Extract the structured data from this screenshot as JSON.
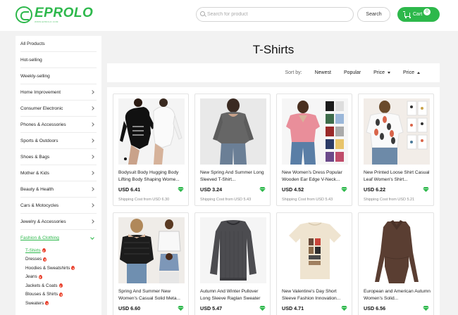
{
  "brand": {
    "name": "EPROLO",
    "tagline": "WWW.EPROLO.COM",
    "accent": "#2db84b"
  },
  "header": {
    "search_placeholder": "Search for product",
    "search_button": "Search",
    "cart_label": "Cart",
    "cart_count": "0"
  },
  "sidebar": {
    "items": [
      {
        "label": "All Products",
        "chevron": false
      },
      {
        "label": "Hot-selling",
        "chevron": false
      },
      {
        "label": "Weekly-selling",
        "chevron": false
      },
      {
        "label": "Home Improvement",
        "chevron": true
      },
      {
        "label": "Consumer Electronic",
        "chevron": true
      },
      {
        "label": "Phones & Accessories",
        "chevron": true
      },
      {
        "label": "Sports & Outdoors",
        "chevron": true
      },
      {
        "label": "Shoes & Bags",
        "chevron": true
      },
      {
        "label": "Mother & Kids",
        "chevron": true
      },
      {
        "label": "Beauty & Health",
        "chevron": true
      },
      {
        "label": "Cars & Motocycles",
        "chevron": true
      },
      {
        "label": "Jewelry & Accessories",
        "chevron": true
      },
      {
        "label": "Fashion & Clothing",
        "chevron": true,
        "expanded": true
      }
    ],
    "subitems": [
      {
        "label": "T-Shirts",
        "hot": true,
        "active": true
      },
      {
        "label": "Dresses",
        "hot": true
      },
      {
        "label": "Hoodies & Sweatshirts",
        "hot": true
      },
      {
        "label": "Jeans",
        "hot": true
      },
      {
        "label": "Jackets & Coats",
        "hot": true
      },
      {
        "label": "Blouses & Shirts",
        "hot": true
      },
      {
        "label": "Sweaters",
        "hot": true
      }
    ]
  },
  "main": {
    "title": "T-Shirts",
    "sort": {
      "label": "Sort by:",
      "options": [
        "Newest",
        "Popular",
        "Price",
        "Price"
      ]
    },
    "products": [
      {
        "name": "Bodysuit Body Hugging Body Lifting Body Shaping Wome...",
        "price": "USD 6.41",
        "shipping": "Shipping Cost from USD 6.30",
        "image": "black-white-bodysuits"
      },
      {
        "name": "New Spring And Summer Long Sleeved T-Shirt...",
        "price": "USD 3.24",
        "shipping": "Shipping Cost from USD 5.43",
        "image": "grey-longsleeve-top"
      },
      {
        "name": "New Women's Dress Popular Wooden Ear Edge V-Neck...",
        "price": "USD 4.52",
        "shipping": "Shipping Cost from USD 5.43",
        "image": "pink-vneck-tee-colors"
      },
      {
        "name": "New Printed Loose Shirt Casual Leaf Women's Shirt...",
        "price": "USD 6.22",
        "shipping": "Shipping Cost from USD 5.21",
        "image": "leaf-print-shirts"
      },
      {
        "name": "Spring And Summer New Women's Casual Solid Meta...",
        "price": "USD 6.60",
        "shipping": "",
        "image": "offshoulder-mesh-tops"
      },
      {
        "name": "Autumn And Winter Pullover Long Sleeve Raglan Sweater",
        "price": "USD 5.47",
        "shipping": "",
        "image": "grey-raglan-sweater"
      },
      {
        "name": "New Valentine's Day Short Sleeve Fashion Innovation...",
        "price": "USD 4.71",
        "shipping": "",
        "image": "love-print-tee"
      },
      {
        "name": "European and American Autumn Women's Solid...",
        "price": "USD 6.56",
        "shipping": "",
        "image": "brown-collar-bodysuit"
      }
    ]
  }
}
